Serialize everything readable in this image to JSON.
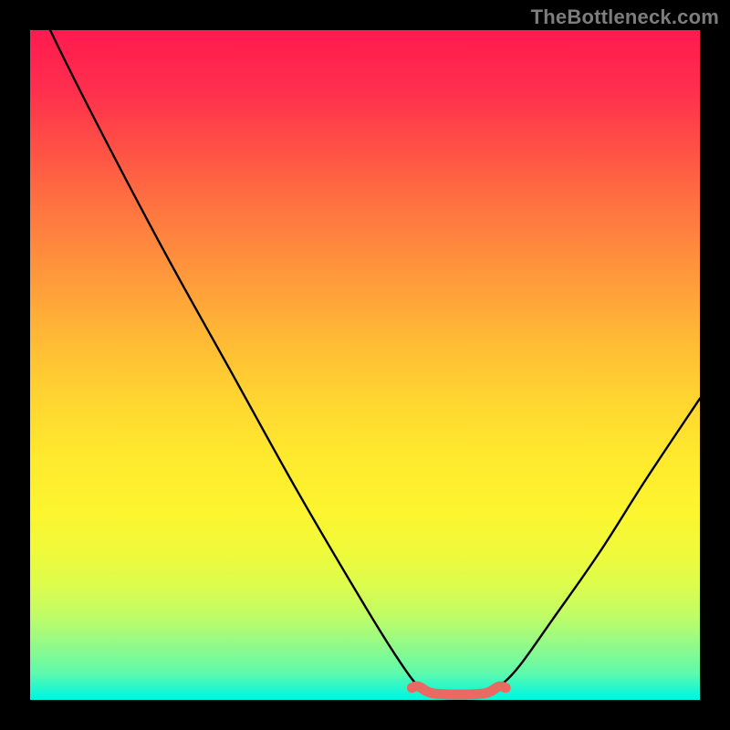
{
  "attribution": "TheBottleneck.com",
  "colors": {
    "page_bg": "#000000",
    "curve_stroke": "#000000",
    "valley_stroke": "#e86a60",
    "gradient_top": "#ff1a4f",
    "gradient_bottom": "#00f7e0",
    "attribution_text": "#7d7d7d"
  },
  "chart_data": {
    "type": "line",
    "title": "",
    "xlabel": "",
    "ylabel": "",
    "xlim": [
      0,
      100
    ],
    "ylim": [
      0,
      100
    ],
    "curve": [
      {
        "x": 0,
        "y": 107
      },
      {
        "x": 3,
        "y": 100
      },
      {
        "x": 10,
        "y": 86
      },
      {
        "x": 20,
        "y": 67
      },
      {
        "x": 30,
        "y": 49
      },
      {
        "x": 40,
        "y": 31
      },
      {
        "x": 50,
        "y": 14
      },
      {
        "x": 55,
        "y": 6
      },
      {
        "x": 58,
        "y": 2
      },
      {
        "x": 60,
        "y": 1
      },
      {
        "x": 64,
        "y": 0.8
      },
      {
        "x": 68,
        "y": 1
      },
      {
        "x": 70,
        "y": 2
      },
      {
        "x": 73,
        "y": 5
      },
      {
        "x": 78,
        "y": 12
      },
      {
        "x": 85,
        "y": 22
      },
      {
        "x": 92,
        "y": 33
      },
      {
        "x": 100,
        "y": 45
      }
    ],
    "valley_range": {
      "x_start": 57,
      "x_end": 71
    }
  }
}
